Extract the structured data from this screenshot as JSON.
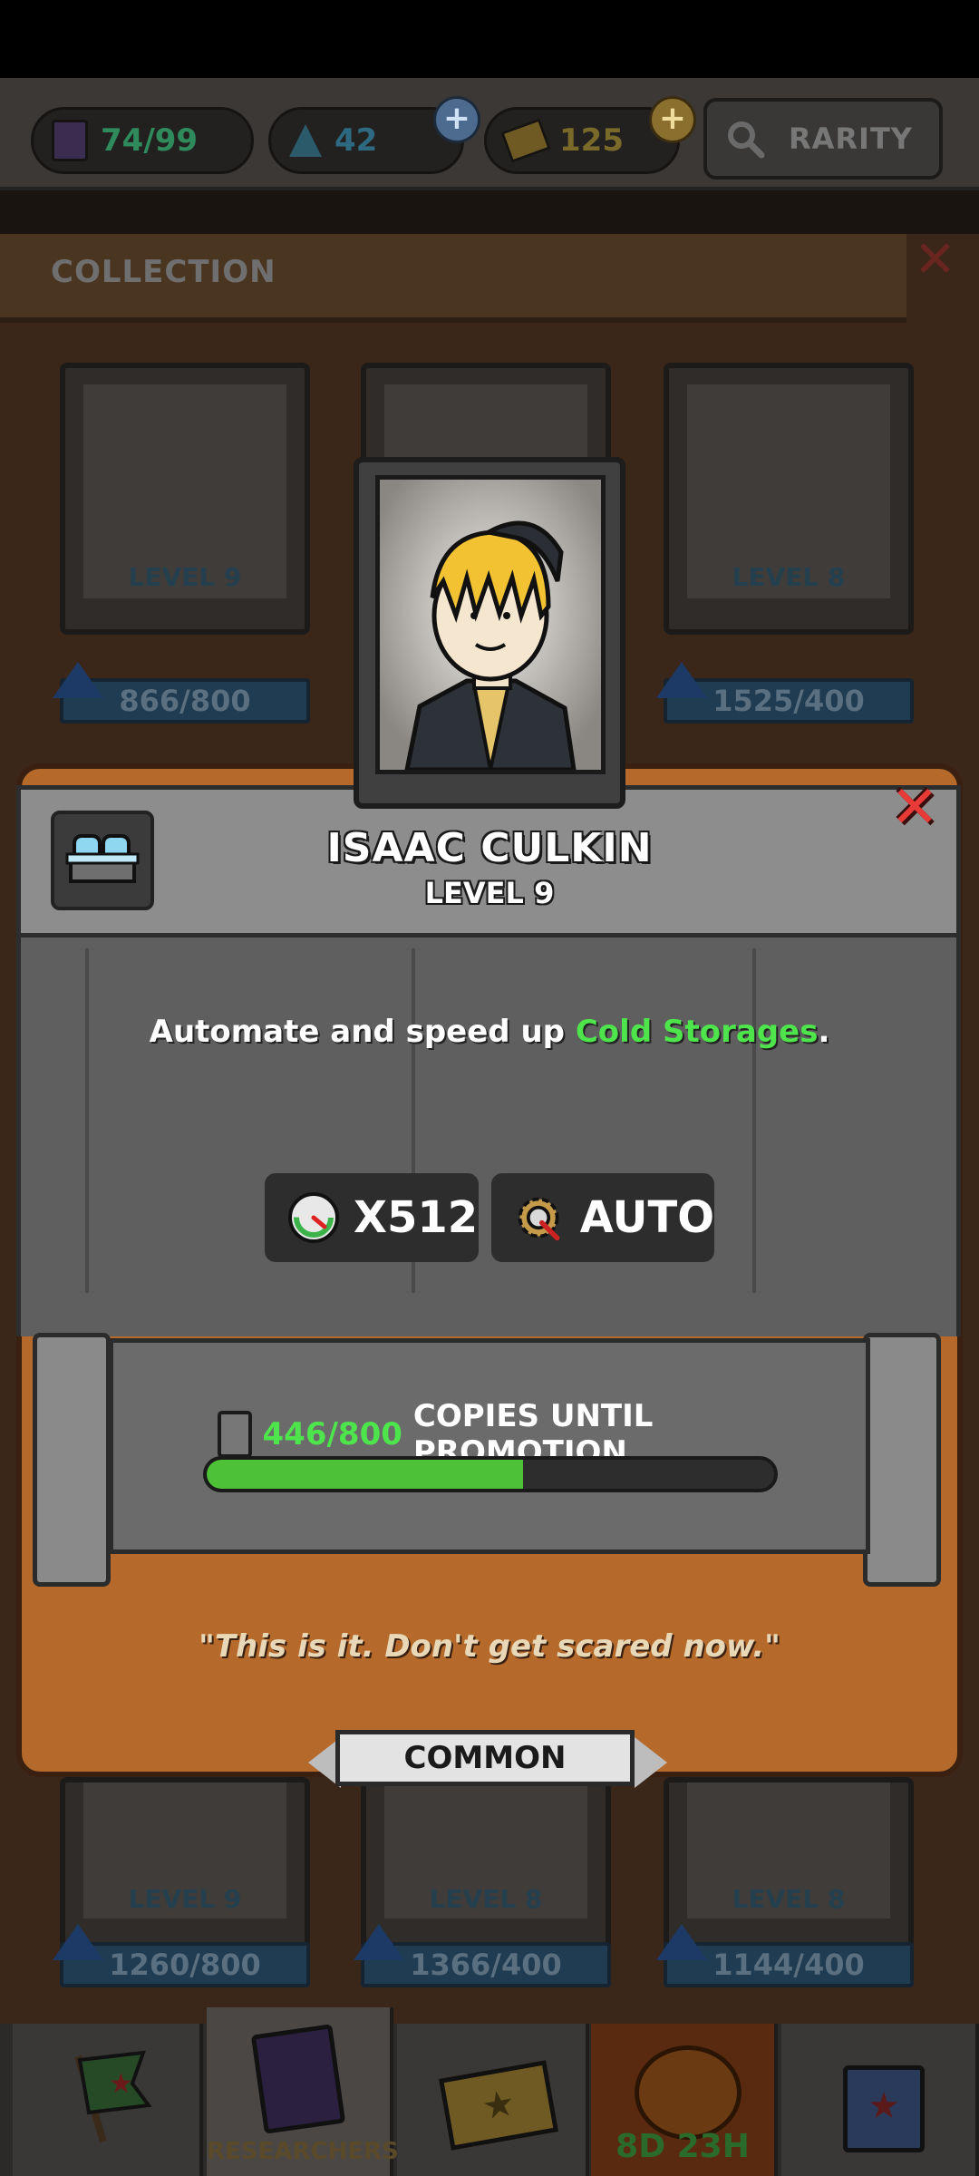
{
  "topbar": {
    "cards_count": "74/99",
    "potion_count": "42",
    "ticket_count": "125",
    "rarity_button": "RARITY"
  },
  "collection": {
    "title": "COLLECTION",
    "cards_top": [
      {
        "level": "LEVEL 9",
        "progress": "866/800"
      },
      {
        "level": "",
        "progress": ""
      },
      {
        "level": "LEVEL 8",
        "progress": "1525/400"
      }
    ],
    "cards_bottom": [
      {
        "level": "LEVEL 9",
        "progress": "1260/800"
      },
      {
        "level": "LEVEL 8",
        "progress": "1366/400"
      },
      {
        "level": "LEVEL 8",
        "progress": "1144/400"
      }
    ]
  },
  "nav": {
    "researchers_label": "RESEARCHERS",
    "event_timer": "8D 23H"
  },
  "detail": {
    "name": "ISAAC CULKIN",
    "level": "LEVEL 9",
    "desc_prefix": "Automate and speed up ",
    "desc_highlight": "Cold Storages",
    "desc_suffix": ".",
    "speed_stat": "X512",
    "auto_stat": "AUTO",
    "copies_value": "446/800",
    "copies_label": "COPIES UNTIL PROMOTION",
    "copies_fraction": 0.5575,
    "quote": "\"This is it. Don't get scared now.\"",
    "rarity": "COMMON"
  },
  "colors": {
    "highlight_green": "#4ee44c",
    "close_red": "#e83a36",
    "progress_green": "#4ec237"
  }
}
